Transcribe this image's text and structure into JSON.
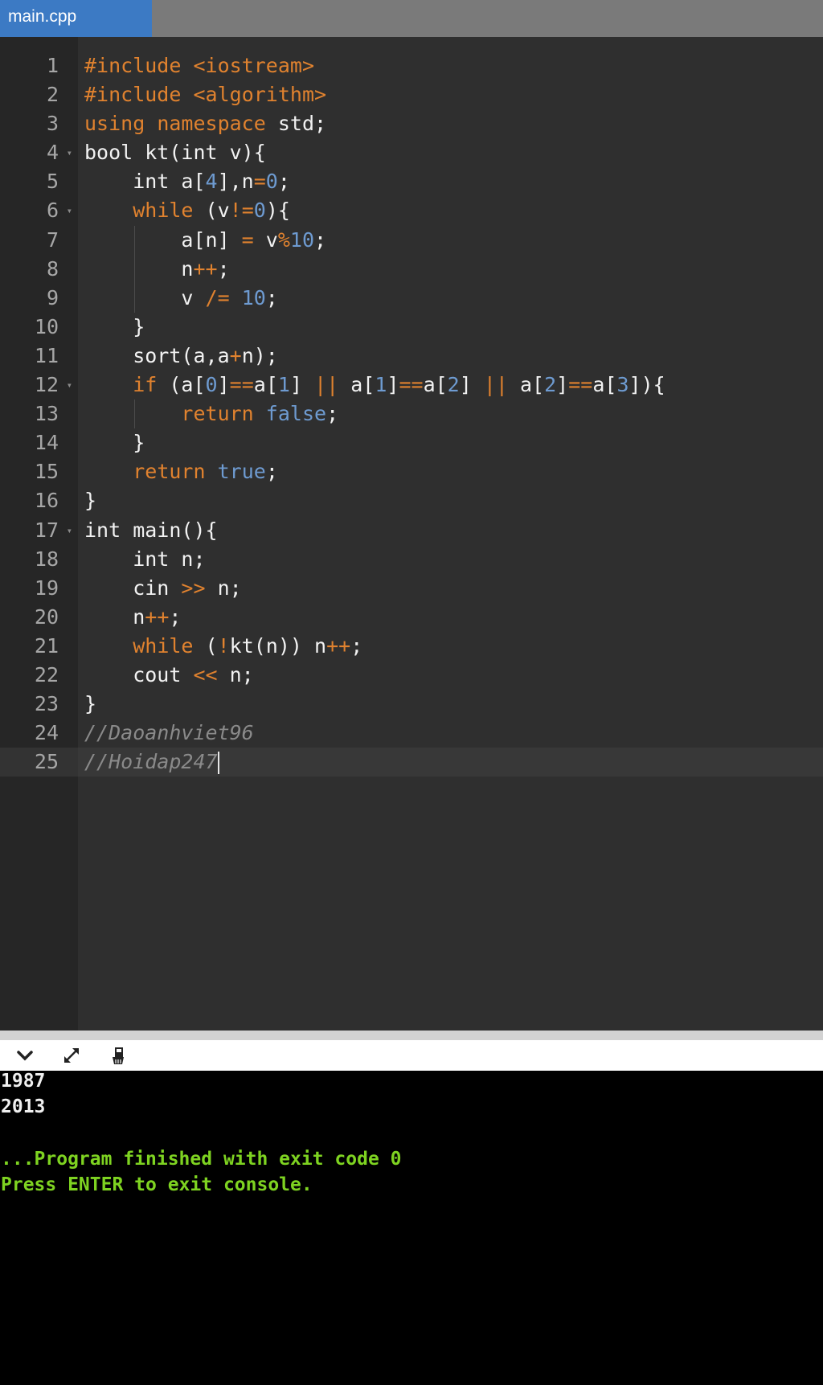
{
  "tab": {
    "label": "main.cpp"
  },
  "editor": {
    "lines": [
      {
        "n": "1",
        "html": "<span class=\"k\">#include</span> <span class=\"k\">&lt;iostream&gt;</span>"
      },
      {
        "n": "2",
        "html": "<span class=\"k\">#include</span> <span class=\"k\">&lt;algorithm&gt;</span>"
      },
      {
        "n": "3",
        "html": "<span class=\"k\">using</span> <span class=\"k\">namespace</span> std;"
      },
      {
        "n": "4",
        "fold": true,
        "html": "bool kt(int v){"
      },
      {
        "n": "5",
        "html": "    int a[<span class=\"n\">4</span>],n<span class=\"k\">=</span><span class=\"n\">0</span>;"
      },
      {
        "n": "6",
        "fold": true,
        "html": "    <span class=\"k\">while</span> (v<span class=\"k\">!=</span><span class=\"n\">0</span>){"
      },
      {
        "n": "7",
        "guides": [
          1
        ],
        "html": "        a[n] <span class=\"k\">=</span> v<span class=\"k\">%</span><span class=\"n\">10</span>;"
      },
      {
        "n": "8",
        "guides": [
          1
        ],
        "html": "        n<span class=\"k\">++</span>;"
      },
      {
        "n": "9",
        "guides": [
          1
        ],
        "html": "        v <span class=\"k\">/=</span> <span class=\"n\">10</span>;"
      },
      {
        "n": "10",
        "html": "    }"
      },
      {
        "n": "11",
        "html": "    sort(a,a<span class=\"k\">+</span>n);"
      },
      {
        "n": "12",
        "fold": true,
        "html": "    <span class=\"k\">if</span> (a[<span class=\"n\">0</span>]<span class=\"k\">==</span>a[<span class=\"n\">1</span>] <span class=\"k\">||</span> a[<span class=\"n\">1</span>]<span class=\"k\">==</span>a[<span class=\"n\">2</span>] <span class=\"k\">||</span> a[<span class=\"n\">2</span>]<span class=\"k\">==</span>a[<span class=\"n\">3</span>]){"
      },
      {
        "n": "13",
        "guides": [
          1
        ],
        "html": "        <span class=\"k\">return</span> <span class=\"n\">false</span>;"
      },
      {
        "n": "14",
        "html": "    }"
      },
      {
        "n": "15",
        "html": "    <span class=\"k\">return</span> <span class=\"n\">true</span>;"
      },
      {
        "n": "16",
        "html": "}"
      },
      {
        "n": "17",
        "fold": true,
        "html": "int main(){"
      },
      {
        "n": "18",
        "html": "    int n;"
      },
      {
        "n": "19",
        "html": "    cin <span class=\"k\">&gt;&gt;</span> n;"
      },
      {
        "n": "20",
        "html": "    n<span class=\"k\">++</span>;"
      },
      {
        "n": "21",
        "html": "    <span class=\"k\">while</span> (<span class=\"k\">!</span>kt(n)) n<span class=\"k\">++</span>;"
      },
      {
        "n": "22",
        "html": "    cout <span class=\"k\">&lt;&lt;</span> n;"
      },
      {
        "n": "23",
        "html": "}"
      },
      {
        "n": "24",
        "html": "<span class=\"c\">//Daoanhviet96</span>"
      },
      {
        "n": "25",
        "active": true,
        "cursor": true,
        "html": "<span class=\"c\">//Hoidap247</span>"
      }
    ]
  },
  "console_toolbar": {
    "icons": [
      "chevron-down-icon",
      "expand-icon",
      "clear-console-icon"
    ]
  },
  "console": {
    "output": [
      "1987",
      "2013"
    ],
    "finished": "...Program finished with exit code 0",
    "press_enter": "Press ENTER to exit console."
  }
}
